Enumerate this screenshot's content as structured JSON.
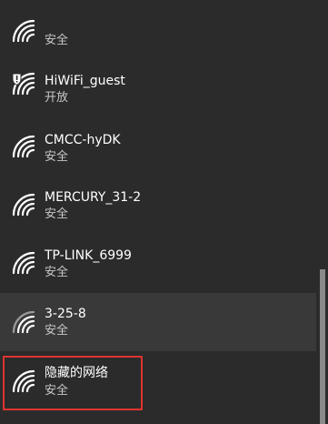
{
  "networks": [
    {
      "name": "",
      "status": "安全",
      "icon": "wifi-icon",
      "secured": true
    },
    {
      "name": "HiWiFi_guest",
      "status": "开放",
      "icon": "wifi-open-warning-icon",
      "secured": false
    },
    {
      "name": "CMCC-hyDK",
      "status": "安全",
      "icon": "wifi-icon",
      "secured": true
    },
    {
      "name": "MERCURY_31-2",
      "status": "安全",
      "icon": "wifi-icon",
      "secured": true
    },
    {
      "name": "TP-LINK_6999",
      "status": "安全",
      "icon": "wifi-icon",
      "secured": true
    },
    {
      "name": "3-25-8",
      "status": "安全",
      "icon": "wifi-icon",
      "secured": true,
      "hovered": true
    },
    {
      "name": "隐藏的网络",
      "status": "安全",
      "icon": "wifi-icon",
      "secured": true,
      "highlighted": true
    }
  ],
  "colors": {
    "background": "#2b2b2b",
    "hover": "#393939",
    "highlight_border": "#e0342f",
    "text": "#ffffff",
    "subtext": "#c8c8c8"
  }
}
